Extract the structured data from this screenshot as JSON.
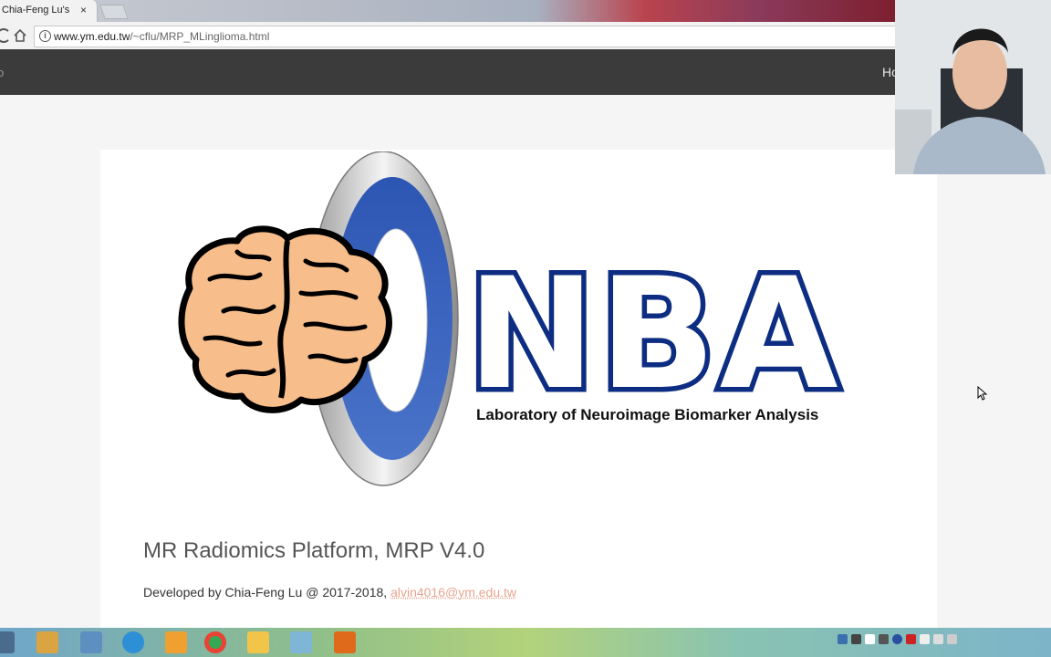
{
  "browser": {
    "tab_title": "Chia-Feng Lu's N",
    "tab_close": "×",
    "url_host": "www.ym.edu.tw",
    "url_path": "/~cflu/MRP_MLinglioma.html",
    "info_icon": "i"
  },
  "site_nav": {
    "left_partial": "o",
    "home_partial": "Ho"
  },
  "logo": {
    "wordmark": "NBA",
    "tagline": "Laboratory of Neuroimage Biomarker Analysis"
  },
  "content": {
    "title": "MR Radiomics Platform, MRP V4.0",
    "credit_prefix": "Developed by Chia-Feng Lu @ 2017-2018,",
    "email": "alvin4016@ym.edu.tw"
  },
  "colors": {
    "navy": "#0d2d82",
    "brain_fill": "#f7bd8b",
    "nav_bg": "#3b3b3b"
  }
}
